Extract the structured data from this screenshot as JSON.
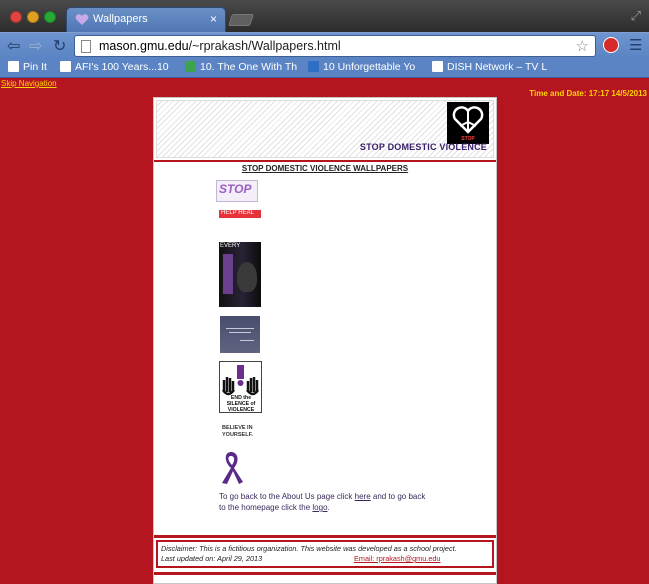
{
  "browser": {
    "tab_title": "Wallpapers",
    "tab_close": "×",
    "url_host": "mason.gmu.edu",
    "url_path": "/~rprakash/Wallpapers.html",
    "icons": {
      "back": "back-arrow-icon",
      "forward": "forward-arrow-icon",
      "reload": "reload-icon",
      "star": "bookmark-star-icon",
      "menu": "menu-icon"
    },
    "bookmarks": [
      {
        "label": "Pin It",
        "icon_color": "#ffffff"
      },
      {
        "label": "AFI's 100 Years...10",
        "icon_color": "#ffffff"
      },
      {
        "label": "10. The One With Th",
        "icon_color": "#3fa34d"
      },
      {
        "label": "10 Unforgettable Yo",
        "icon_color": "#2f6fc3"
      },
      {
        "label": "DISH Network – TV L",
        "icon_color": "#ffffff"
      }
    ]
  },
  "page": {
    "skip_navigation": "Skip Navigation",
    "datetime": "Time and Date: 17:17 14/5/2013",
    "banner_title": "STOP DOMESTIC VIOLENCE",
    "logo_text": "STOP",
    "heading": "STOP DOMESTIC VIOLENCE WALLPAPERS",
    "thumbnails": [
      {
        "name": "stop-domestic-violence-wallpaper",
        "text": "STOP"
      },
      {
        "name": "help-heal-wallpaper",
        "text": "HELP HEAL"
      },
      {
        "name": "every-stop-wallpaper",
        "text": "EVERY"
      },
      {
        "name": "quote-wallpaper",
        "text": ""
      },
      {
        "name": "end-silence-wallpaper",
        "text": "END the SILENCE of VIOLENCE"
      },
      {
        "name": "believe-in-yourself-wallpaper",
        "text": "BELIEVE IN YOURSELF."
      },
      {
        "name": "purple-ribbon-wallpaper",
        "text": ""
      }
    ],
    "body_text_1": "To go back to the About Us page click ",
    "link_here": "here",
    "body_text_2": " and to go back to the homepage click the ",
    "link_logo": "logo",
    "body_text_3": ".",
    "disclaimer": "Disclaimer: This is a fictitious organization. This website was developed as a school project.",
    "last_updated": "Last updated on: April 29, 2013",
    "email": "Email: rprakash@gmu.edu"
  },
  "colors": {
    "background": "#b5151f",
    "accent_text": "#ffd200",
    "title_purple": "#39206a"
  }
}
